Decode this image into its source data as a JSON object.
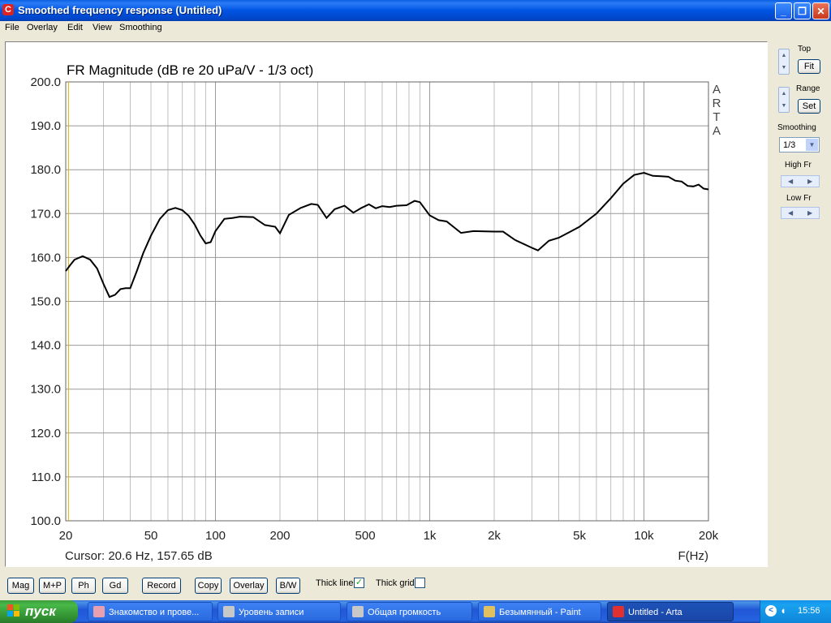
{
  "window": {
    "title": "Smoothed frequency response (Untitled)",
    "icon": "arta-app-icon"
  },
  "menu": [
    "File",
    "Overlay",
    "Edit",
    "View",
    "Smoothing"
  ],
  "chart_data": {
    "type": "line",
    "title": "FR Magnitude (dB re 20 uPa/V - 1/3 oct)",
    "xlabel": "F(Hz)",
    "ylabel": "",
    "xscale": "log",
    "xlim": [
      20,
      20000
    ],
    "ylim": [
      100,
      200
    ],
    "xticks": [
      "20",
      "50",
      "100",
      "200",
      "500",
      "1k",
      "2k",
      "5k",
      "10k",
      "20k"
    ],
    "yticks": [
      "200.0",
      "190.0",
      "180.0",
      "170.0",
      "160.0",
      "150.0",
      "140.0",
      "130.0",
      "120.0",
      "110.0",
      "100.0"
    ],
    "watermark": "ARTA",
    "cursor_text": "Cursor: 20.6 Hz, 157.65 dB",
    "cursor_x": 20.6,
    "series": [
      {
        "x": [
          20,
          21,
          22,
          24,
          26,
          28,
          30,
          32,
          34,
          36,
          38,
          40,
          43,
          46,
          50,
          55,
          60,
          65,
          70,
          75,
          80,
          85,
          90,
          95,
          100,
          110,
          120,
          130,
          150,
          170,
          190,
          200,
          220,
          250,
          280,
          300,
          330,
          360,
          400,
          440,
          480,
          520,
          560,
          600,
          650,
          700,
          780,
          850,
          900,
          1000,
          1100,
          1200,
          1400,
          1600,
          2000,
          2200,
          2500,
          3000,
          3200,
          3600,
          4000,
          4500,
          5000,
          6000,
          7000,
          8000,
          9000,
          10000,
          11000,
          12000,
          13000,
          14000,
          15000,
          16000,
          17000,
          18000,
          19000,
          20000
        ],
        "values": [
          156.9,
          158.3,
          159.5,
          160.3,
          159.5,
          157.5,
          154.0,
          151.0,
          151.5,
          152.8,
          153.0,
          153.0,
          157.0,
          161.0,
          165.0,
          168.8,
          170.8,
          171.3,
          170.8,
          169.5,
          167.5,
          165.0,
          163.2,
          163.5,
          166.0,
          168.8,
          169.0,
          169.3,
          169.2,
          167.4,
          167.0,
          165.5,
          169.7,
          171.3,
          172.2,
          172.0,
          169.0,
          171.0,
          171.8,
          170.2,
          171.3,
          172.1,
          171.2,
          171.7,
          171.5,
          171.8,
          171.9,
          172.9,
          172.6,
          169.6,
          168.5,
          168.2,
          165.6,
          166.0,
          165.9,
          165.9,
          164.0,
          162.2,
          161.6,
          163.8,
          164.5,
          165.8,
          167.0,
          170.0,
          173.5,
          176.8,
          178.8,
          179.3,
          178.6,
          178.5,
          178.4,
          177.5,
          177.3,
          176.3,
          176.2,
          176.6,
          175.7,
          175.5
        ]
      }
    ]
  },
  "side": {
    "top_label": "Top",
    "fit_label": "Fit",
    "range_label": "Range",
    "set_label": "Set",
    "smoothing_label": "Smoothing",
    "smoothing_value": "1/3",
    "high_fr_label": "High Fr",
    "low_fr_label": "Low Fr"
  },
  "toolbar": {
    "mag": "Mag",
    "mp": "M+P",
    "ph": "Ph",
    "gd": "Gd",
    "record": "Record",
    "copy": "Copy",
    "overlay": "Overlay",
    "bw": "B/W",
    "thick_line": "Thick line",
    "thick_line_checked": true,
    "thick_grid": "Thick grid",
    "thick_grid_checked": false
  },
  "taskbar": {
    "start": "пуск",
    "tasks": [
      {
        "label": "Знакомство и прове...",
        "icon": "ie-page-icon",
        "color": "#E8A0B0"
      },
      {
        "label": "Уровень записи",
        "icon": "volume-icon",
        "color": "#C8C8C8"
      },
      {
        "label": "Общая громкость",
        "icon": "volume-icon",
        "color": "#C8C8C8"
      },
      {
        "label": "Безымянный - Paint",
        "icon": "paint-icon",
        "color": "#E0C060"
      },
      {
        "label": "Untitled - Arta",
        "icon": "arta-icon",
        "color": "#E03030"
      }
    ],
    "clock": "15:56"
  }
}
